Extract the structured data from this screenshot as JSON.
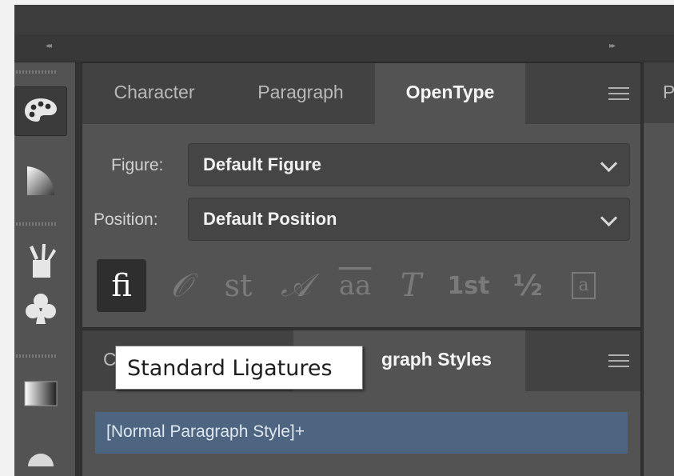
{
  "panel_top": {
    "tabs": [
      "Character",
      "Paragraph",
      "OpenType"
    ],
    "active_tab": "OpenType",
    "figure": {
      "label": "Figure:",
      "value": "Default Figure"
    },
    "position": {
      "label": "Position:",
      "value": "Default Position"
    },
    "glyph_buttons": [
      {
        "icon": "standard-ligatures-icon",
        "glyph": "ﬁ",
        "active": true
      },
      {
        "icon": "contextual-alternates-icon",
        "glyph": "𝒪",
        "active": false
      },
      {
        "icon": "discretionary-ligatures-icon",
        "glyph": "st",
        "active": false
      },
      {
        "icon": "swash-icon",
        "glyph": "𝒜",
        "active": false
      },
      {
        "icon": "stylistic-alternates-icon",
        "glyph": "aa",
        "active": false
      },
      {
        "icon": "titling-alternates-icon",
        "glyph": "T",
        "active": false
      },
      {
        "icon": "ordinals-icon",
        "glyph": "1st",
        "active": false
      },
      {
        "icon": "fractions-icon",
        "glyph": "½",
        "active": false
      },
      {
        "icon": "stylistic-sets-icon",
        "glyph": "a",
        "active": false
      }
    ]
  },
  "panel_bottom": {
    "tab_left": "C",
    "tab_right": "graph Styles",
    "selected_style": "[Normal Paragraph Style]+"
  },
  "right_panel": {
    "tab": "P"
  },
  "tooltip": {
    "text": "Standard Ligatures"
  },
  "toolstrip": {
    "tools": [
      "color-palette-icon",
      "color-guide-icon",
      "brushes-icon",
      "symbols-icon",
      "gradient-icon"
    ]
  },
  "colors": {
    "panel_bg": "#535353",
    "tab_bg": "#424242",
    "selection": "#4d6580"
  }
}
